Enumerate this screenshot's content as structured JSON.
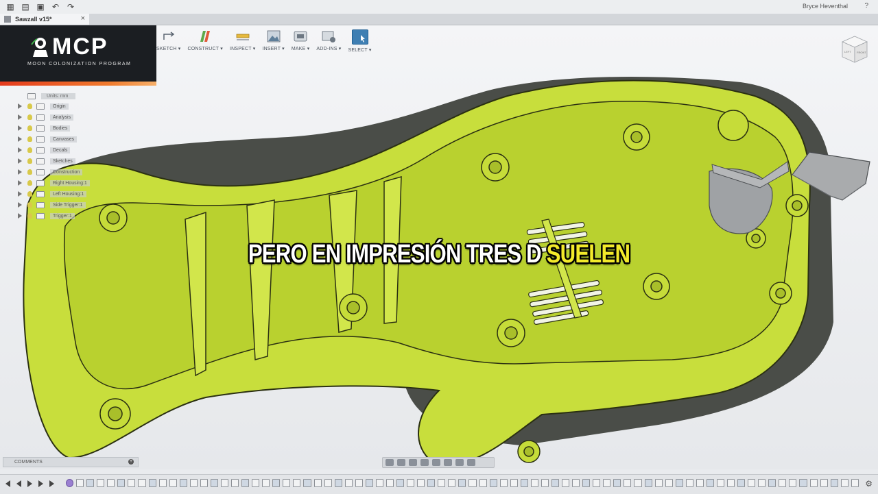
{
  "app": {
    "user_name": "Bryce Heventhal",
    "help": "?"
  },
  "document_tab": {
    "title": "Sawzall v15*",
    "close": "×"
  },
  "toolbar": {
    "tools": [
      {
        "label": "SKETCH ▾",
        "icon": "sketch-icon"
      },
      {
        "label": "CONSTRUCT ▾",
        "icon": "construct-icon"
      },
      {
        "label": "INSPECT ▾",
        "icon": "inspect-icon"
      },
      {
        "label": "INSERT ▾",
        "icon": "insert-icon"
      },
      {
        "label": "MAKE ▾",
        "icon": "make-icon"
      },
      {
        "label": "ADD-INS ▾",
        "icon": "add-ins-icon"
      },
      {
        "label": "SELECT ▾",
        "icon": "select-icon"
      }
    ]
  },
  "logo": {
    "main": "MCP",
    "sub": "MOON COLONIZATION PROGRAM"
  },
  "browser": {
    "units": "Units: mm",
    "nodes": [
      "Origin",
      "Analysis",
      "Bodies",
      "Canvases",
      "Decals",
      "Sketches",
      "Construction",
      "Right Housing:1",
      "Left Housing:1",
      "Side Trigger:1",
      "Trigger:1"
    ]
  },
  "viewcube": {
    "left": "LEFT",
    "front": "FRONT"
  },
  "subtitle": {
    "main": "PERO EN IMPRESIÓN TRES D ",
    "highlight": "SUELEN"
  },
  "comments": {
    "label": "COMMENTS"
  },
  "colors": {
    "model_green": "#c8de3c",
    "model_edge": "#2b3012",
    "subtitle_highlight": "#f3ea2a",
    "select_blue": "#3f7fb3"
  }
}
